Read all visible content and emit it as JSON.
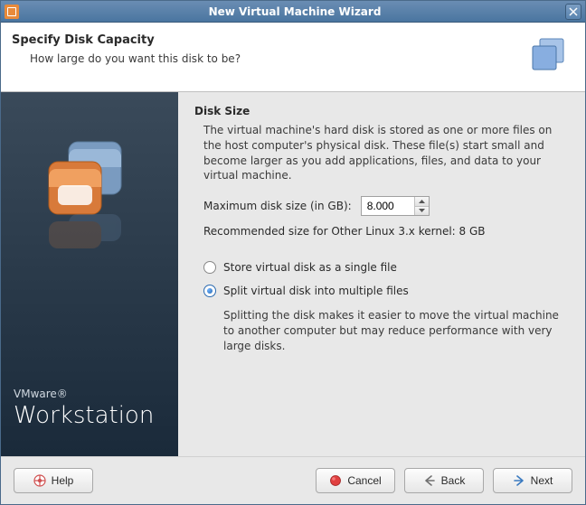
{
  "window": {
    "title": "New Virtual Machine Wizard"
  },
  "header": {
    "title": "Specify Disk Capacity",
    "subtitle": "How large do you want this disk to be?"
  },
  "sidebar": {
    "brand": "VMware®",
    "product": "Workstation"
  },
  "disk": {
    "section_title": "Disk Size",
    "description": "The virtual machine's hard disk is stored as one or more files on the host computer's physical disk. These file(s) start small and become larger as you add applications, files, and data to your virtual machine.",
    "max_size_label": "Maximum disk size (in GB):",
    "max_size_value": "8.000",
    "recommended": "Recommended size for Other Linux 3.x kernel: 8 GB",
    "radio_single": "Store virtual disk as a single file",
    "radio_split": "Split virtual disk into multiple files",
    "split_desc": "Splitting the disk makes it easier to move the virtual machine to another computer but may reduce performance with very large disks."
  },
  "footer": {
    "help": "Help",
    "cancel": "Cancel",
    "back": "Back",
    "next": "Next"
  }
}
